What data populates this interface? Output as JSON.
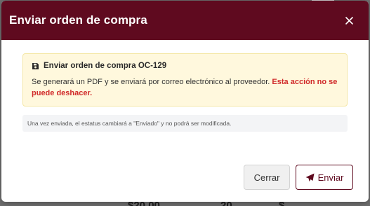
{
  "colors": {
    "accent": "#5f0a1f",
    "warning_text": "#d02a2a",
    "alert_bg": "#fff8dd",
    "note_bg": "#f3f4f6"
  },
  "background": {
    "amount_text": "$20.00",
    "qty_text": "20",
    "extra_text": "$"
  },
  "modal": {
    "title": "Enviar orden de compra",
    "close_icon": "close-icon",
    "alert": {
      "icon": "save-icon",
      "title": "Enviar orden de compra OC-129",
      "text": "Se generará un PDF y se enviará por correo electrónico al proveedor.",
      "warning": "Esta acción no se puede deshacer."
    },
    "note": "Una vez enviada, el estatus cambiará a \"Enviado\" y no podrá ser modificada.",
    "footer": {
      "cancel_label": "Cerrar",
      "send_label": "Enviar",
      "send_icon": "paper-plane-icon"
    }
  }
}
